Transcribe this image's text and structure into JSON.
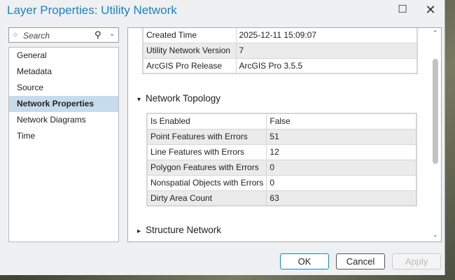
{
  "window": {
    "title": "Layer Properties: Utility Network",
    "maximize_icon": "maximize-icon",
    "close_icon": "close-icon"
  },
  "sidebar": {
    "search_placeholder": "Search",
    "items": [
      {
        "label": "General"
      },
      {
        "label": "Metadata"
      },
      {
        "label": "Source"
      },
      {
        "label": "Network Properties",
        "selected": true
      },
      {
        "label": "Network Diagrams"
      },
      {
        "label": "Time"
      }
    ]
  },
  "general_table": [
    [
      "Created Time",
      "2025-12-11 15:09:07"
    ],
    [
      "Utility Network Version",
      "7"
    ],
    [
      "ArcGIS Pro Release",
      "ArcGIS Pro 3.5.5"
    ]
  ],
  "topology": {
    "header": "Network Topology",
    "expanded": true,
    "rows": [
      [
        "Is Enabled",
        "False"
      ],
      [
        "Point Features with Errors",
        "51"
      ],
      [
        "Line Features with Errors",
        "12"
      ],
      [
        "Polygon Features with Errors",
        "0"
      ],
      [
        "Nonspatial Objects with Errors",
        "0"
      ],
      [
        "Dirty Area Count",
        "63"
      ]
    ]
  },
  "structure": {
    "header": "Structure Network",
    "expanded": false
  },
  "buttons": {
    "ok": "OK",
    "cancel": "Cancel",
    "apply": "Apply",
    "apply_enabled": false
  },
  "colors": {
    "accent": "#1b82c4",
    "selected": "#c6dcec"
  }
}
